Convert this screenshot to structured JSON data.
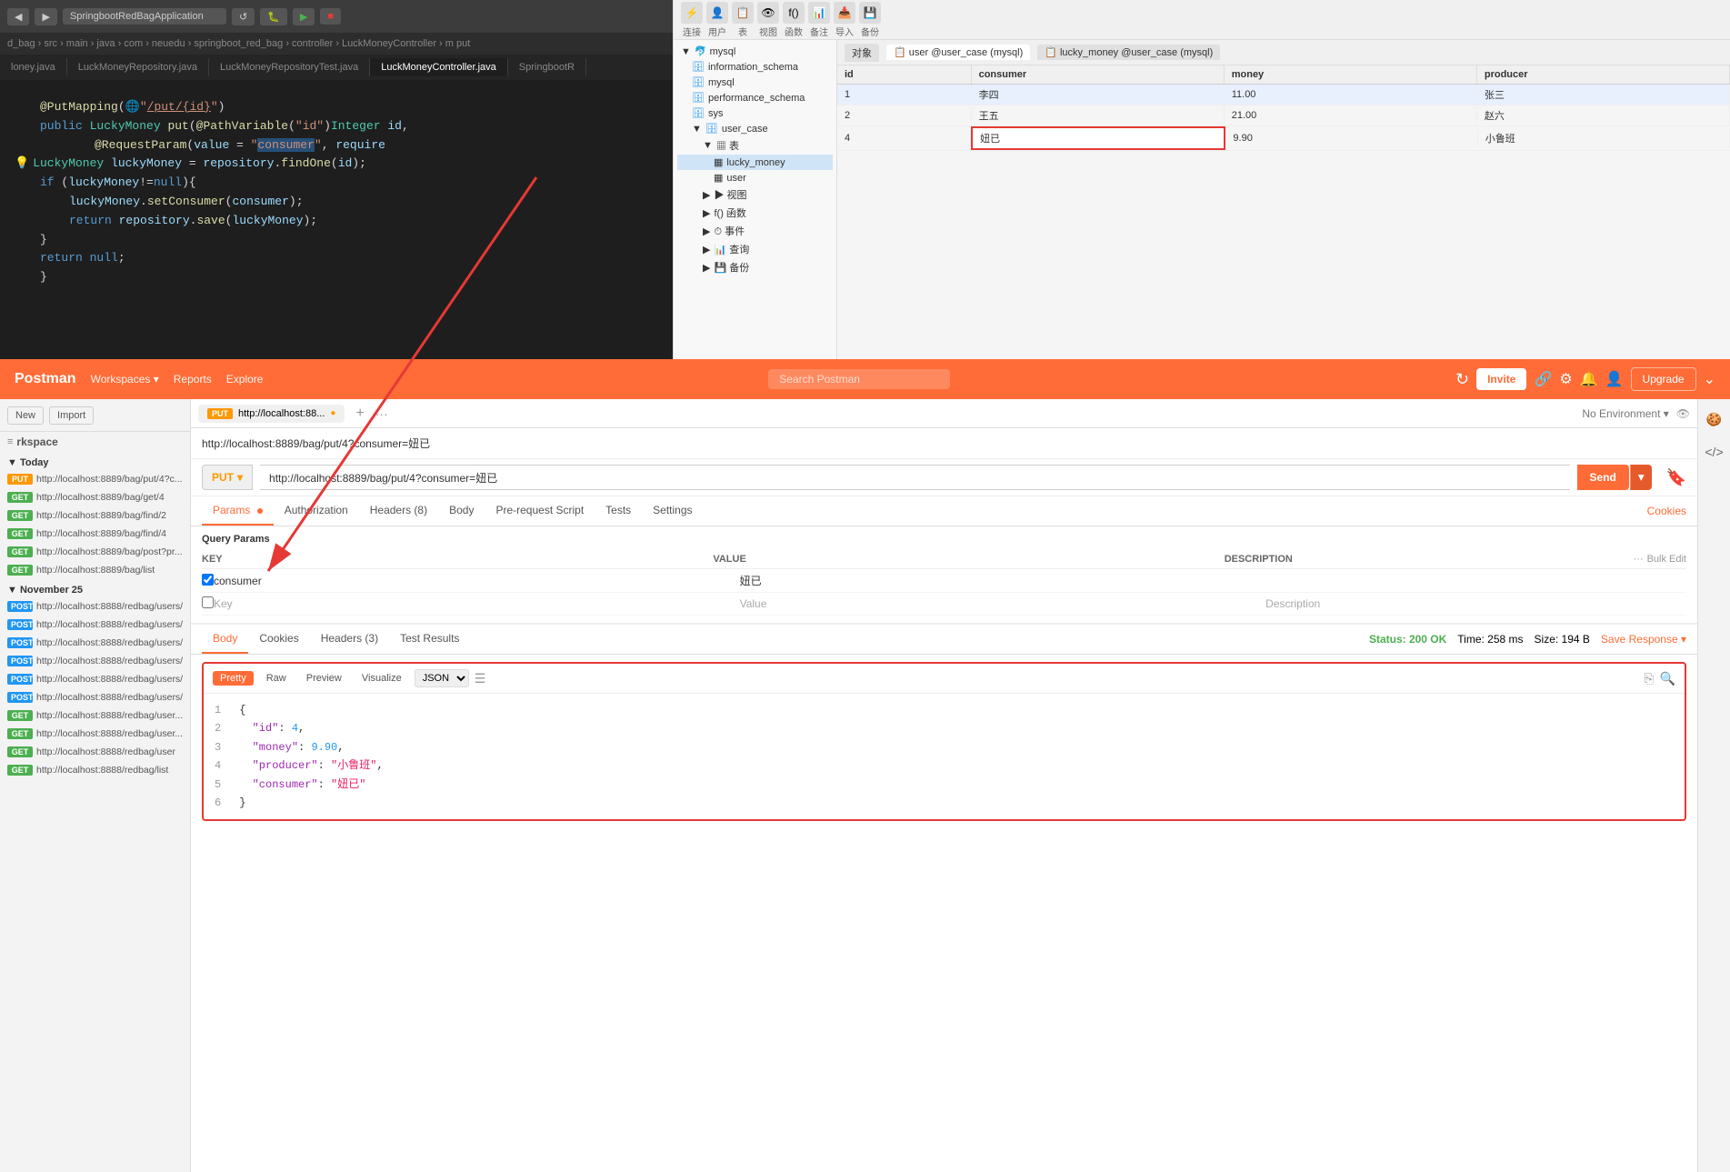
{
  "ide": {
    "toolbar": {
      "back": "◀",
      "forward": "▶",
      "app_name": "SpringbootRedBagApplication",
      "refresh": "↺",
      "debug": "⚙",
      "run": "▶",
      "stop": "■"
    },
    "breadcrumb": "d_bag › src › main › java › com › neuedu › springboot_red_bag › controller › LuckMoneyController › m put",
    "tabs": [
      {
        "label": "loney.java",
        "active": false
      },
      {
        "label": "LuckMoneyRepository.java",
        "active": false
      },
      {
        "label": "LuckMoneyRepositoryTest.java",
        "active": false
      },
      {
        "label": "LuckMoneyController.java",
        "active": true
      },
      {
        "label": "SpringbootR",
        "active": false
      }
    ],
    "code_lines": [
      {
        "num": "",
        "content": "@PutMapping(\"/put/{id}\")"
      },
      {
        "num": "",
        "content": "public LuckyMoney put(@PathVariable(\"id\")Integer id,"
      },
      {
        "num": "",
        "content": "        @RequestParam(value = \"consumer\", require"
      },
      {
        "num": "",
        "content": "    LuckyMoney luckyMoney = repository.findOne(id);"
      },
      {
        "num": "",
        "content": "    if (luckyMoney!=null){"
      },
      {
        "num": "",
        "content": "        luckyMoney.setConsumer(consumer);"
      },
      {
        "num": "",
        "content": "        return repository.save(luckyMoney);"
      },
      {
        "num": "",
        "content": "    }"
      },
      {
        "num": "",
        "content": "    return null;"
      },
      {
        "num": "",
        "content": "}"
      }
    ]
  },
  "db": {
    "toolbar_icons": [
      "连接",
      "用户",
      "表",
      "视图",
      "函数",
      "备注",
      "导入",
      "备份"
    ],
    "tabs": [
      "对象",
      "user @user_case (mysql)",
      "lucky_money @user_case (mysql)"
    ],
    "tree": {
      "root": "mysql",
      "items": [
        {
          "label": "information_schema",
          "type": "db",
          "expanded": false
        },
        {
          "label": "mysql",
          "type": "db",
          "expanded": false
        },
        {
          "label": "performance_schema",
          "type": "db",
          "expanded": false
        },
        {
          "label": "sys",
          "type": "db",
          "expanded": false
        },
        {
          "label": "user_case",
          "type": "db",
          "expanded": true
        },
        {
          "label": "表",
          "type": "group",
          "indent": 1,
          "expanded": true
        },
        {
          "label": "lucky_money",
          "type": "table",
          "indent": 2,
          "selected": true
        },
        {
          "label": "user",
          "type": "table",
          "indent": 2
        },
        {
          "label": "视图",
          "type": "group",
          "indent": 1
        },
        {
          "label": "f() 函数",
          "type": "group",
          "indent": 1
        },
        {
          "label": "事件",
          "type": "group",
          "indent": 1
        },
        {
          "label": "查询",
          "type": "group",
          "indent": 1
        },
        {
          "label": "备份",
          "type": "group",
          "indent": 1
        }
      ]
    },
    "table": {
      "columns": [
        "id",
        "consumer",
        "money",
        "producer"
      ],
      "rows": [
        {
          "id": "1",
          "consumer": "李四",
          "money": "11.00",
          "producer": "张三"
        },
        {
          "id": "2",
          "consumer": "王五",
          "money": "21.00",
          "producer": "赵六"
        },
        {
          "id": "4",
          "consumer": "妞已",
          "money": "9.90",
          "producer": "小鲁班",
          "highlighted": true
        }
      ]
    }
  },
  "postman": {
    "header": {
      "title": "Postman",
      "nav": [
        "Workspaces",
        "Reports",
        "Explore"
      ],
      "search_placeholder": "Search Postman",
      "invite_label": "Invite",
      "upgrade_label": "Upgrade"
    },
    "sidebar": {
      "new_label": "New",
      "import_label": "Import",
      "filter_icon": "≡",
      "groups": [
        {
          "label": "Today",
          "items": [
            {
              "method": "PUT",
              "url": "http://localhost:8889/bag/put/4?c..."
            },
            {
              "method": "GET",
              "url": "http://localhost:8889/bag/get/4"
            },
            {
              "method": "GET",
              "url": "http://localhost:8889/bag/find/2"
            },
            {
              "method": "GET",
              "url": "http://localhost:8889/bag/find/4"
            },
            {
              "method": "GET",
              "url": "http://localhost:8889/bag/post?pr..."
            },
            {
              "method": "GET",
              "url": "http://localhost:8889/bag/list"
            }
          ]
        },
        {
          "label": "November 25",
          "items": [
            {
              "method": "POST",
              "url": "http://localhost:8888/redbag/users/"
            },
            {
              "method": "POST",
              "url": "http://localhost:8888/redbag/users/"
            },
            {
              "method": "POST",
              "url": "http://localhost:8888/redbag/users/"
            },
            {
              "method": "POST",
              "url": "http://localhost:8888/redbag/users/"
            },
            {
              "method": "POST",
              "url": "http://localhost:8888/redbag/users/"
            },
            {
              "method": "POST",
              "url": "http://localhost:8888/redbag/users/"
            },
            {
              "method": "GET",
              "url": "http://localhost:8888/redbag/user..."
            },
            {
              "method": "GET",
              "url": "http://localhost:8888/redbag/user..."
            },
            {
              "method": "GET",
              "url": "http://localhost:8888/redbag/user"
            },
            {
              "method": "GET",
              "url": "http://localhost:8888/redbag/list"
            }
          ]
        }
      ]
    },
    "request": {
      "current_tab": "PUT http://localhost:88...",
      "url_display": "http://localhost:8889/bag/put/4?consumer=妞已",
      "method": "PUT",
      "url": "http://localhost:8889/bag/put/4?consumer=妞已",
      "tabs": [
        "Params",
        "Authorization",
        "Headers (8)",
        "Body",
        "Pre-request Script",
        "Tests",
        "Settings"
      ],
      "active_tab": "Params",
      "cookies_link": "Cookies",
      "save_label": "Save",
      "query_params_title": "Query Params",
      "params_headers": [
        "KEY",
        "VALUE",
        "DESCRIPTION",
        "Bulk Edit"
      ],
      "params": [
        {
          "key": "consumer",
          "value": "妞已",
          "description": "",
          "checked": true
        }
      ],
      "empty_row": {
        "key": "Key",
        "value": "Value",
        "description": "Description"
      }
    },
    "response": {
      "tabs": [
        "Body",
        "Cookies",
        "Headers (3)",
        "Test Results"
      ],
      "active_tab": "Body",
      "status": "200 OK",
      "time": "258 ms",
      "size": "194 B",
      "save_response": "Save Response",
      "format_tabs": [
        "Pretty",
        "Raw",
        "Preview",
        "Visualize"
      ],
      "active_format": "Pretty",
      "format_select": "JSON",
      "json_content": "{\n  \"id\": 4,\n  \"money\": 9.90,\n  \"producer\": \"小鲁班\",\n  \"consumer\": \"妞已\"\n}"
    }
  }
}
